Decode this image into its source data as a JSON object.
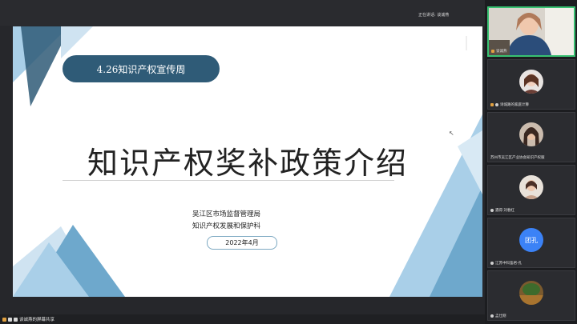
{
  "top": {
    "speaking_label": "正在讲话: 谈诚燕"
  },
  "slide": {
    "tag": "4.26知识产权宣传周",
    "title": "知识产权奖补政策介绍",
    "org_line1": "吴江区市场监督管理局",
    "org_line2": "知识产权发展和保护科",
    "date": "2022年4月"
  },
  "bottom": {
    "share_label": "谈诚燕的屏幕共享"
  },
  "participants": [
    {
      "name": "谈诚燕",
      "kind": "video"
    },
    {
      "name": "诗城路的家庭计算",
      "kind": "photo"
    },
    {
      "name": "苏州市吴江区产业协会知识产权服",
      "kind": "photo"
    },
    {
      "name": "遇得·刘春红",
      "kind": "photo"
    },
    {
      "name": "江苏中科鉴君-孔",
      "kind": "text",
      "avatar_text": "团孔"
    },
    {
      "name": "孟仕刚",
      "kind": "photo"
    }
  ],
  "colors": {
    "accent_dark": "#2f5b77",
    "accent_light": "#a9cfe8",
    "active_border": "#38c172"
  }
}
